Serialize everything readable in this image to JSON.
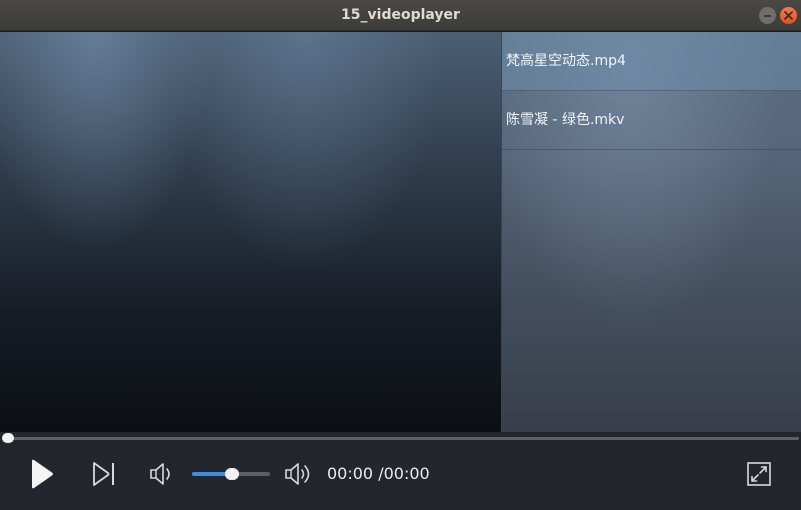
{
  "window": {
    "title": "15_videoplayer"
  },
  "playlist": {
    "items": [
      {
        "label": "梵高星空动态.mp4",
        "selected": true
      },
      {
        "label": "陈雪凝 - 绿色.mkv",
        "selected": false
      }
    ]
  },
  "playback": {
    "progress_fraction": 0.0,
    "time_display": "00:00 /00:00"
  },
  "volume": {
    "level_fraction": 0.5
  },
  "icons": {
    "play": "play-icon",
    "next": "skip-next-icon",
    "volume_down": "volume-low-icon",
    "volume_up": "volume-high-icon",
    "fullscreen": "fullscreen-icon",
    "minimize": "minimize-icon",
    "close": "close-icon"
  },
  "colors": {
    "accent": "#3d8ee0",
    "close_button": "#e95420"
  }
}
